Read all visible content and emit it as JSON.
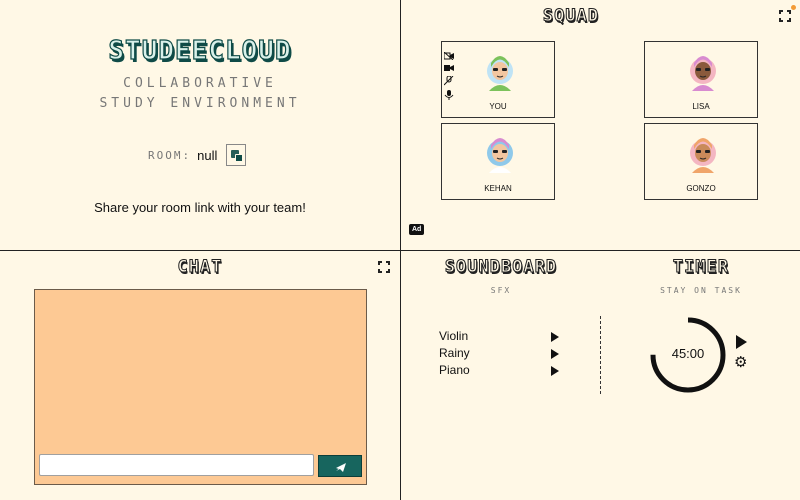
{
  "app": {
    "logo_text": "STUDEECLOUD",
    "tagline_line1": "COLLABORATIVE",
    "tagline_line2": "STUDY ENVIRONMENT",
    "room_label": "ROOM:",
    "room_value": "null",
    "share_text": "Share your room link with your team!"
  },
  "squad": {
    "title": "SQUAD",
    "members": [
      {
        "name": "YOU",
        "hair": "#7cc25b",
        "skin": "#f2c6a0",
        "bg": "#bfe3f5",
        "shirt": "#7cc25b"
      },
      {
        "name": "LISA",
        "hair": "#d88bd0",
        "skin": "#8a5a3c",
        "bg": "#f4b6c2",
        "shirt": "#d88bd0"
      },
      {
        "name": "KEHAN",
        "hair": "#d88bd0",
        "skin": "#f2c6a0",
        "bg": "#8fc9ea",
        "shirt": "#ffffff"
      },
      {
        "name": "GONZO",
        "hair": "#f0a56a",
        "skin": "#c98a5a",
        "bg": "#f4b6c2",
        "shirt": "#f0a56a"
      }
    ],
    "ad_label": "Ad"
  },
  "chat": {
    "title": "CHAT",
    "input_value": "",
    "colors": {
      "panel": "#fdc994",
      "send": "#17655e"
    }
  },
  "soundboard": {
    "title": "SOUNDBOARD",
    "subtitle": "SFX",
    "sounds": [
      "Violin",
      "Rainy",
      "Piano"
    ]
  },
  "timer": {
    "title": "TIMER",
    "subtitle": "STAY ON TASK",
    "time": "45:00",
    "progress": 0.75
  },
  "colors": {
    "background": "#fff8e6",
    "accent": "#0f4b47",
    "notify": "#f39b36"
  }
}
